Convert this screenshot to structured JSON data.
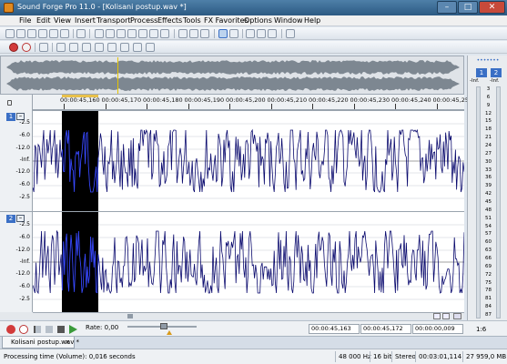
{
  "window": {
    "title": "Sound Forge Pro 11.0 - [Kolisani postup.wav *]",
    "min_label": "–",
    "max_label": "□",
    "close_label": "✕"
  },
  "menu": [
    "File",
    "Edit",
    "View",
    "Insert",
    "Transport",
    "Process",
    "Effects",
    "Tools",
    "FX Favorites",
    "Options",
    "Window",
    "Help"
  ],
  "ruler": {
    "labels": [
      "00:00:45,160",
      "00:00:45,170",
      "00:00:45,180",
      "00:00:45,190",
      "00:00:45,200",
      "00:00:45,210",
      "00:00:45,220",
      "00:00:45,230",
      "00:00:45,240",
      "00:00:45,250"
    ]
  },
  "channels": [
    {
      "badge": "1",
      "scale": [
        "-2.5",
        "-6.0",
        "-12.0",
        "-Inf.",
        "-12.0",
        "-6.0",
        "-2.5"
      ]
    },
    {
      "badge": "2",
      "scale": [
        "-2.5",
        "-6.0",
        "-12.0",
        "-Inf.",
        "-12.0",
        "-6.0",
        "-2.5"
      ]
    }
  ],
  "channel_min_label": "–",
  "vu_meter": {
    "dots": "•••••••",
    "buttons": [
      "1",
      "2"
    ],
    "peaks": [
      "-Inf.",
      "-Inf."
    ],
    "scale": [
      "3",
      "6",
      "9",
      "12",
      "15",
      "18",
      "21",
      "24",
      "27",
      "30",
      "33",
      "36",
      "39",
      "42",
      "45",
      "48",
      "51",
      "54",
      "57",
      "60",
      "63",
      "66",
      "69",
      "72",
      "75",
      "78",
      "81",
      "84",
      "87"
    ]
  },
  "transport": {
    "rate_label": "Rate: 0,00",
    "time_start": "00:00:45,163",
    "time_end": "00:00:45,172",
    "time_length": "00:00:00,009",
    "zoom": "1:6"
  },
  "file_tab": {
    "name": "Kolisani postup.wav *",
    "close": "×"
  },
  "status": {
    "message": "Processing time (Volume): 0,016 seconds",
    "sample_rate": "48 000 Hz",
    "bit_depth": "16 bit",
    "channels": "Stereo",
    "length": "00:03:01,114",
    "disk": "27 959,0 MB"
  },
  "colors": {
    "waveform": "#0a0a6e",
    "selection": "#000000",
    "title_bar": "#3b6b96",
    "meter_button": "#3a6fc5"
  }
}
